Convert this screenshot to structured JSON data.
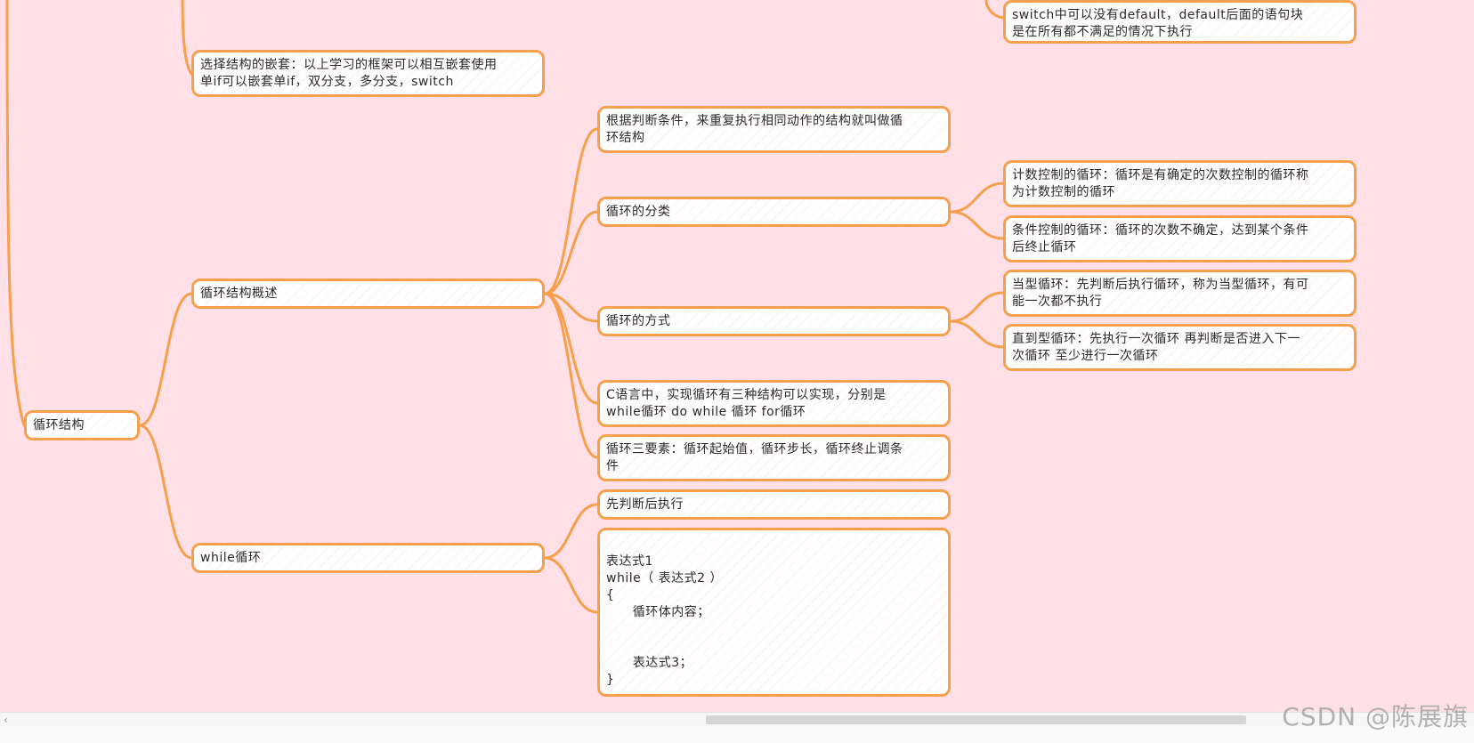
{
  "mindmap": {
    "root": {
      "label": "循环结构"
    },
    "nesting_note": {
      "label": "选择结构的嵌套：以上学习的框架可以相互嵌套使用\n单if可以嵌套单if，双分支，多分支，switch"
    },
    "switch_note": {
      "label": "switch中可以没有default，default后面的语句块\n是在所有都不满足的情况下执行"
    },
    "overview": {
      "label": "循环结构概述",
      "definition": "根据判断条件，来重复执行相同动作的结构就叫做循\n环结构",
      "classification": {
        "label": "循环的分类",
        "count_controlled": "计数控制的循环：循环是有确定的次数控制的循环称\n为计数控制的循环",
        "condition_controlled": "条件控制的循环：循环的次数不确定，达到某个条件\n后终止循环"
      },
      "methods": {
        "label": "循环的方式",
        "while_type": "当型循环：先判断后执行循环，称为当型循环，有可\n能一次都不执行",
        "until_type": "直到型循环：先执行一次循环 再判断是否进入下一\n次循环 至少进行一次循环"
      },
      "c_structures": "C语言中，实现循环有三种结构可以实现，分别是\nwhile循环 do while 循环 for循环",
      "three_elements": "循环三要素：循环起始值，循环步长，循环终止调条\n件"
    },
    "while_loop": {
      "label": "while循环",
      "check_first": "先判断后执行",
      "syntax": "表达式1\nwhile（ 表达式2 ）\n{\n      循环体内容；\n\n\n      表达式3；\n}"
    }
  },
  "scrollbar": {
    "left_arrow": "‹"
  },
  "watermark": "CSDN @陈展旗",
  "colors": {
    "background": "#ffe0e6",
    "node_border": "#f6a04d",
    "connector": "#f6a04d"
  }
}
